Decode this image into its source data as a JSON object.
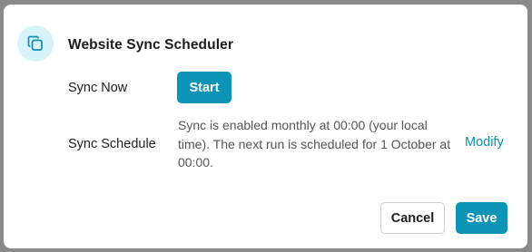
{
  "dialog": {
    "title": "Website Sync Scheduler",
    "header_icon": "copy-icon",
    "accent_color": "#0d94b6",
    "icon_bg_color": "#d7f4fb"
  },
  "sync_now": {
    "label": "Sync Now",
    "button_label": "Start"
  },
  "sync_schedule": {
    "label": "Sync Schedule",
    "description": "Sync is enabled monthly at 00:00 (your local time). The next run is scheduled for 1 October at 00:00.",
    "modify_label": "Modify"
  },
  "footer": {
    "cancel_label": "Cancel",
    "save_label": "Save"
  }
}
